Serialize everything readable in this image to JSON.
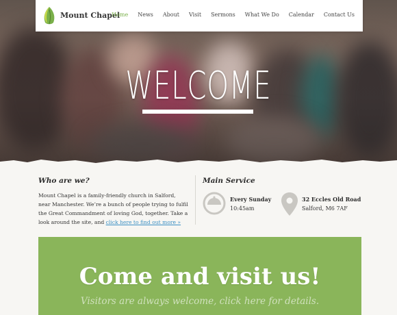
{
  "brand": {
    "name": "Mount Chapel"
  },
  "nav": {
    "items": [
      {
        "label": "Home",
        "active": true
      },
      {
        "label": "News"
      },
      {
        "label": "About"
      },
      {
        "label": "Visit"
      },
      {
        "label": "Sermons"
      },
      {
        "label": "What We Do"
      },
      {
        "label": "Calendar"
      },
      {
        "label": "Contact Us"
      }
    ]
  },
  "hero": {
    "heading": "WELCOME"
  },
  "about": {
    "title": "Who are we?",
    "body": "Mount Chapel is a family-friendly church in Salford, near Manchester.  We’re a bunch of people trying to fulfil the Great Commandment of loving God, together. Take a look around the site, and ",
    "link": "click here to find out more »"
  },
  "service": {
    "title": "Main Service",
    "day": "Every Sunday",
    "time": "10:45am",
    "address_line1": "32 Eccles Old Road",
    "address_line2": "Salford, M6 7AF"
  },
  "cta": {
    "title": "Come and visit us!",
    "subtitle": "Visitors are always welcome, click here for details."
  },
  "colors": {
    "accent": "#7ab04a",
    "cta_bg": "#8ab55a",
    "link": "#3a8fc3"
  },
  "icons": [
    "leaf-logo-icon",
    "clock-icon",
    "map-pin-icon"
  ]
}
